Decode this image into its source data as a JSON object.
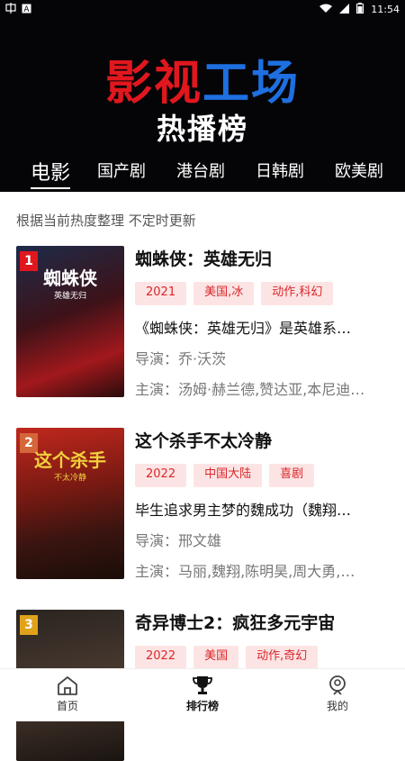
{
  "status_bar": {
    "left_icons": [
      "carrier-icon",
      "notification-a-icon"
    ],
    "time": "11:54"
  },
  "header": {
    "brand_red": "影视",
    "brand_blue": "工场",
    "subtitle": "热播榜",
    "tabs": [
      {
        "label": "电影",
        "active": true
      },
      {
        "label": "国产剧",
        "active": false
      },
      {
        "label": "港台剧",
        "active": false
      },
      {
        "label": "日韩剧",
        "active": false
      },
      {
        "label": "欧美剧",
        "active": false
      }
    ]
  },
  "note": "根据当前热度整理 不定时更新",
  "items": [
    {
      "rank": "1",
      "poster_title": "蜘蛛侠",
      "poster_sub": "英雄无归",
      "title": "蜘蛛侠：英雄无归",
      "tags": [
        "2021",
        "美国,冰",
        "动作,科幻"
      ],
      "desc": "《蜘蛛侠：英雄无归》是英雄系…",
      "director": "导演：乔·沃茨",
      "cast": "主演：汤姆·赫兰德,赞达亚,本尼迪…"
    },
    {
      "rank": "2",
      "poster_title": "这个杀手",
      "poster_sub": "不太冷静",
      "title": "这个杀手不太冷静",
      "tags": [
        "2022",
        "中国大陆",
        "喜剧"
      ],
      "desc": "毕生追求男主梦的魏成功（魏翔…",
      "director": "导演：邢文雄",
      "cast": "主演：马丽,魏翔,陈明昊,周大勇,…"
    },
    {
      "rank": "3",
      "poster_title": "",
      "poster_sub": "",
      "title": "奇异博士2：疯狂多元宇宙",
      "tags": [
        "2022",
        "美国",
        "动作,奇幻"
      ],
      "desc": "",
      "director": "",
      "cast": ""
    }
  ],
  "bottom_nav": [
    {
      "label": "首页",
      "icon": "home-icon",
      "active": false
    },
    {
      "label": "排行榜",
      "icon": "trophy-icon",
      "active": true
    },
    {
      "label": "我的",
      "icon": "profile-icon",
      "active": false
    }
  ],
  "colors": {
    "header_bg": "#050508",
    "brand_red": "#e1171e",
    "brand_blue": "#1e6fe0",
    "tag_bg": "#fde4e4",
    "tag_text": "#d9262a",
    "rank1": "#e1171e",
    "rank2": "#d4663a",
    "rank3": "#e0a21a"
  }
}
